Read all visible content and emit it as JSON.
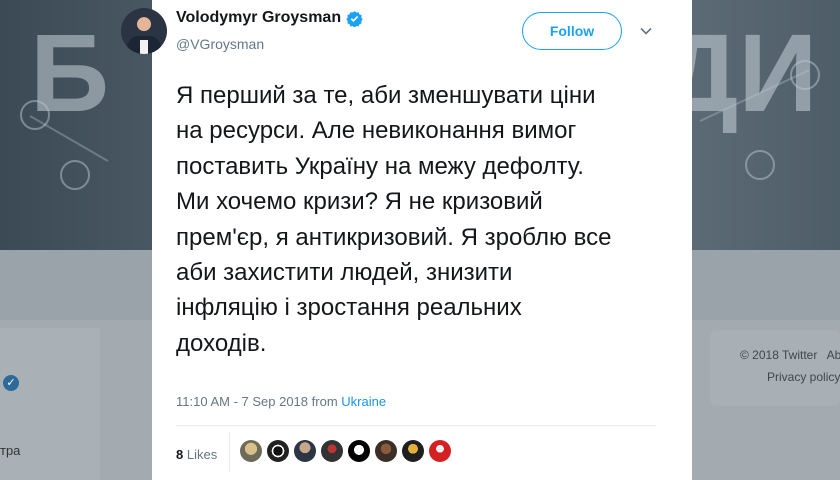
{
  "background": {
    "banner_letters": [
      "Б",
      "ДИ"
    ],
    "left_partial_text": "тра",
    "footer_copyright": "© 2018 Twitter",
    "footer_about": "Ab",
    "footer_privacy": "Privacy policy"
  },
  "tweet": {
    "author_name": "Volodymyr Groysman",
    "author_handle": "@VGroysman",
    "follow_label": "Follow",
    "text": "Я перший за те, аби зменшувати ціни\nна ресурси. Але невиконання вимог\nпоставить Україну на межу дефолту.\nМи хочемо кризи? Я не кризовий\nпрем'єр, я антикризовий. Я зроблю все\nаби захистити людей, знизити\nінфляцію і зростання реальних\nдоходів.",
    "timestamp": "11:10 AM - 7 Sep 2018",
    "from_label": "from",
    "location": "Ukraine",
    "likes_count": "8",
    "likes_label": "Likes"
  },
  "colors": {
    "accent": "#1da1f2",
    "link": "#1b95e0",
    "verified": "#1da1f2",
    "muted_text": "#657786"
  },
  "icons": {
    "verified": "verified-badge-icon",
    "menu": "chevron-down-icon"
  }
}
